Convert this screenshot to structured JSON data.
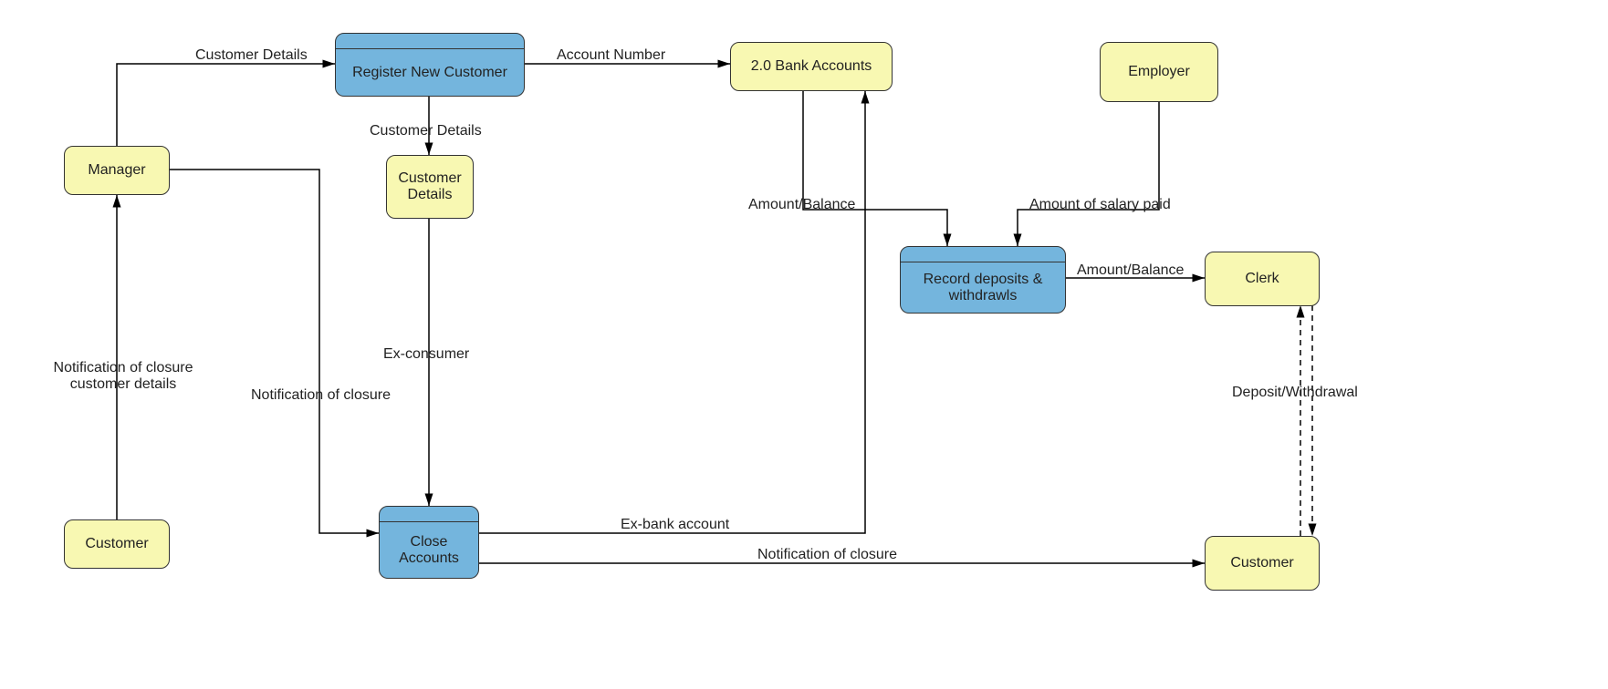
{
  "nodes": {
    "manager": "Manager",
    "customer_left": "Customer",
    "register": "Register New Customer",
    "customer_details_store": "Customer\nDetails",
    "close_accounts": "Close\nAccounts",
    "bank_accounts": "2.0 Bank Accounts",
    "employer": "Employer",
    "record_dw": "Record deposits &\nwithdrawls",
    "clerk": "Clerk",
    "customer_right": "Customer"
  },
  "edges": {
    "manager_to_register": "Customer Details",
    "register_to_bank": "Account Number",
    "register_to_store": "Customer Details",
    "store_to_close": "Ex-consumer",
    "manager_to_close": "Notification of closure",
    "customer_to_manager": "Notification of closure\ncustomer details",
    "close_to_bank": "Ex-bank account",
    "close_to_customer": "Notification of closure",
    "bank_to_record": "Amount/Balance",
    "employer_to_record": "Amount of salary paid",
    "record_to_clerk": "Amount/Balance",
    "clerk_customer": "Deposit/Withdrawal"
  }
}
